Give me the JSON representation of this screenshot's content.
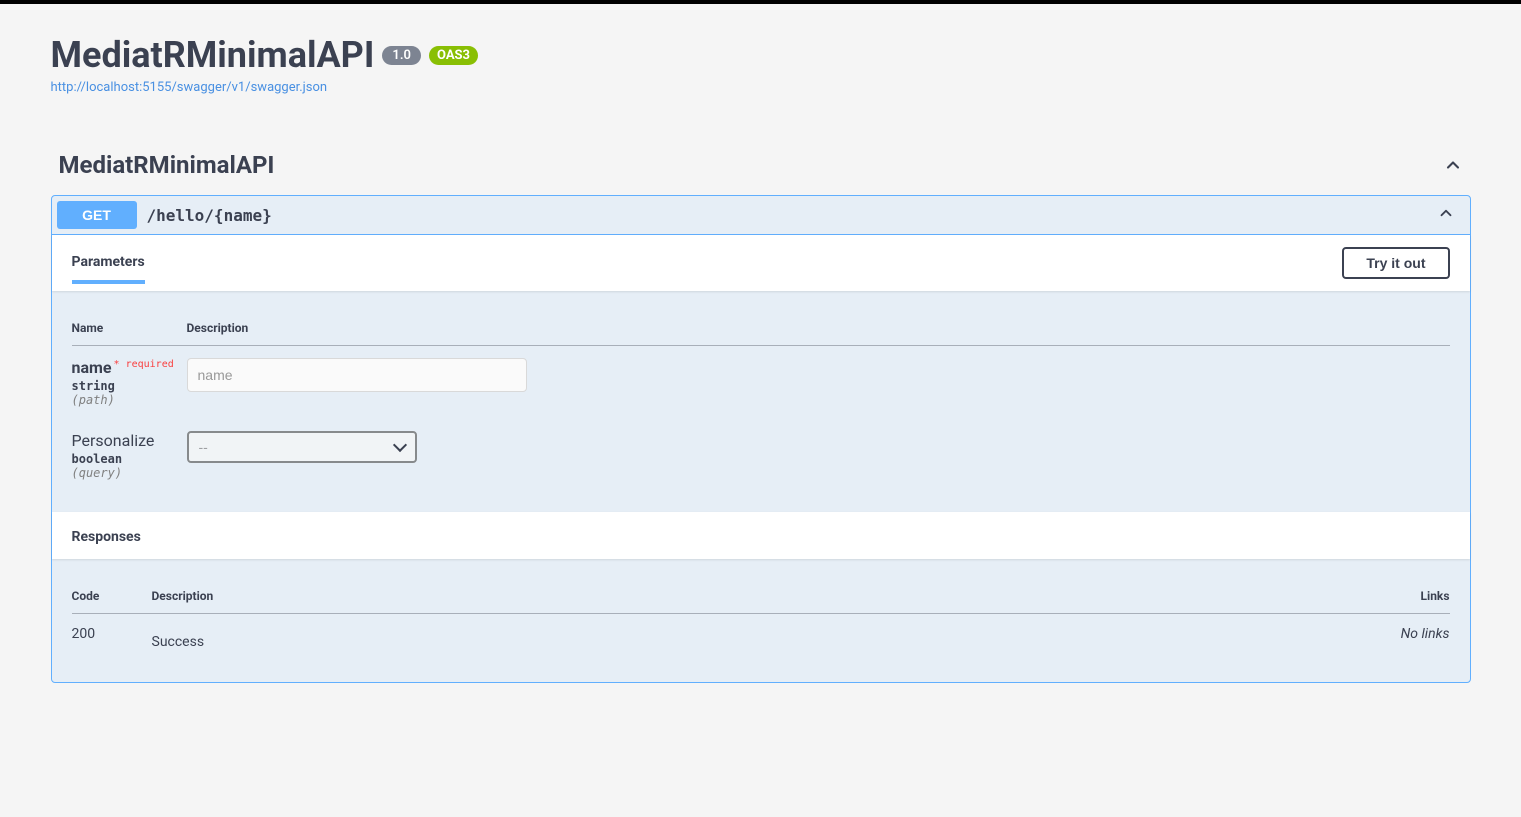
{
  "header": {
    "title": "MediatRMinimalAPI",
    "version": "1.0",
    "oas": "OAS3",
    "spec_url": "http://localhost:5155/swagger/v1/swagger.json"
  },
  "tag": {
    "name": "MediatRMinimalAPI"
  },
  "operation": {
    "method": "GET",
    "path": "/hello/{name}",
    "parameters_heading": "Parameters",
    "try_label": "Try it out",
    "col_name": "Name",
    "col_description": "Description",
    "params": [
      {
        "name": "name",
        "required_label": "* required",
        "type": "string",
        "in": "(path)",
        "placeholder": "name"
      },
      {
        "name": "Personalize",
        "type": "boolean",
        "in": "(query)",
        "select_value": "--"
      }
    ],
    "responses_heading": "Responses",
    "resp_col_code": "Code",
    "resp_col_desc": "Description",
    "resp_col_links": "Links",
    "responses": [
      {
        "code": "200",
        "description": "Success",
        "links": "No links"
      }
    ]
  }
}
